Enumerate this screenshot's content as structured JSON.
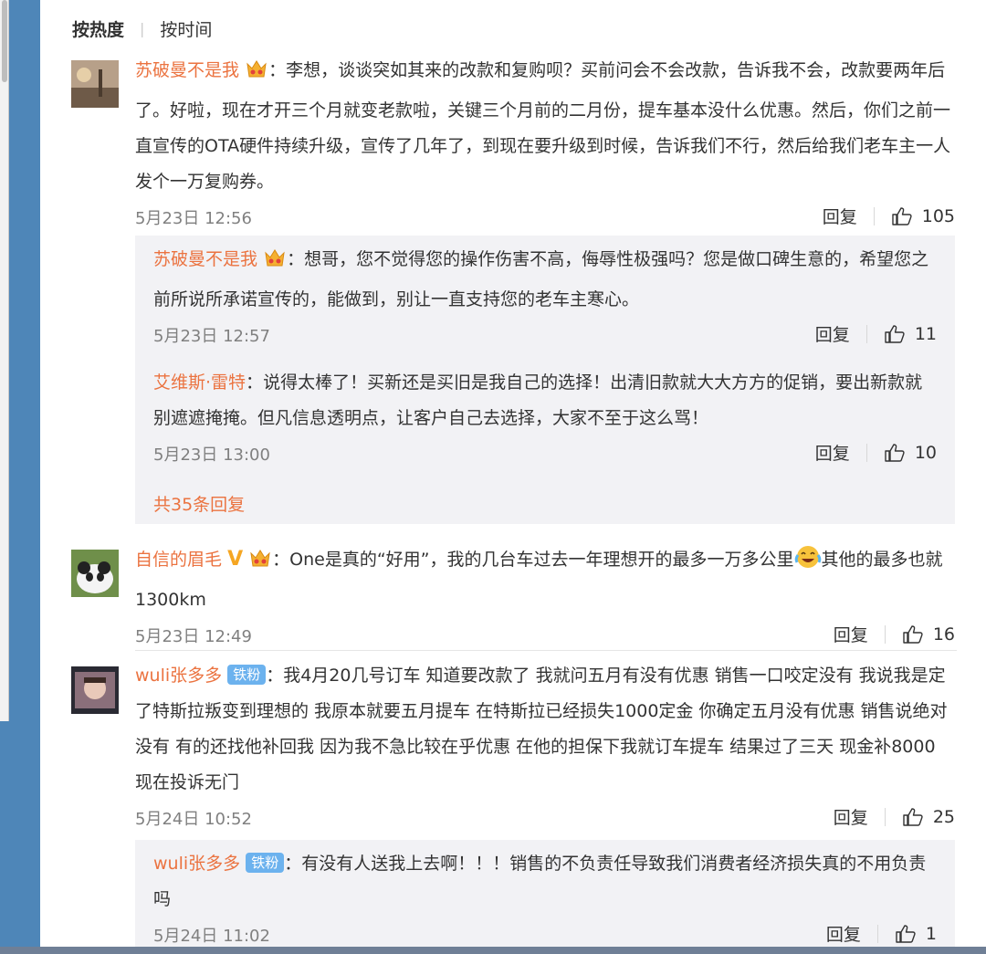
{
  "sort": {
    "hot": "按热度",
    "time": "按时间"
  },
  "comments": [
    {
      "user": "苏破曼不是我",
      "sep": "：",
      "text": "李想，谈谈突如其来的改款和复购呗？买前问会不会改款，告诉我不会，改款要两年后了。好啦，现在才开三个月就变老款啦，关键三个月前的二月份，提车基本没什么优惠。然后，你们之前一直宣传的OTA硬件持续升级，宣传了几年了，到现在要升级到时候，告诉我们不行，然后给我们老车主一人发个一万复购券。",
      "time": "5月23日 12:56",
      "reply_label": "回复",
      "likes": "105",
      "replies": [
        {
          "user": "苏破曼不是我",
          "sep": "：",
          "text": "想哥，您不觉得您的操作伤害不高，侮辱性极强吗？您是做口碑生意的，希望您之前所说所承诺宣传的，能做到，别让一直支持您的老车主寒心。",
          "time": "5月23日 12:57",
          "reply_label": "回复",
          "likes": "11"
        },
        {
          "user": "艾维斯·雷特",
          "sep": "：",
          "text": "说得太棒了！买新还是买旧是我自己的选择！出清旧款就大大方方的促销，要出新款就别遮遮掩掩。但凡信息透明点，让客户自己去选择，大家不至于这么骂！",
          "time": "5月23日 13:00",
          "reply_label": "回复",
          "likes": "10"
        }
      ],
      "more": "共35条回复"
    },
    {
      "user": "自信的眉毛",
      "vip": "V",
      "sep": "：",
      "text_a": "One是真的“好用”，我的几台车过去一年理想开的最多一万多公里",
      "text_b": "其他的最多也就1300km",
      "time": "5月23日 12:49",
      "reply_label": "回复",
      "likes": "16"
    },
    {
      "user": "wuli张多多",
      "badge": "铁粉",
      "sep": "：",
      "text": "我4月20几号订车 知道要改款了 我就问五月有没有优惠 销售一口咬定没有 我说我是定了特斯拉叛变到理想的 我原本就要五月提车 在特斯拉已经损失1000定金 你确定五月没有优惠 销售说绝对没有 有的还找他补回我 因为我不急比较在乎优惠 在他的担保下我就订车提车 结果过了三天 现金补8000 现在投诉无门",
      "time": "5月24日 10:52",
      "reply_label": "回复",
      "likes": "25",
      "replies": [
        {
          "user": "wuli张多多",
          "badge": "铁粉",
          "sep": "：",
          "text": "有没有人送我上去啊！！！销售的不负责任导致我们消费者经济损失真的不用负责吗",
          "time": "5月24日 11:02",
          "reply_label": "回复",
          "likes": "1"
        }
      ]
    }
  ],
  "colors": {
    "username": "#eb7340",
    "reply_bg": "#f2f2f5",
    "badge": "#6cb2ee",
    "sidebar": "#4e86b8"
  },
  "icons": [
    "thumbs-up-icon",
    "crown-emoji-icon",
    "laughing-crying-emoji-icon"
  ]
}
